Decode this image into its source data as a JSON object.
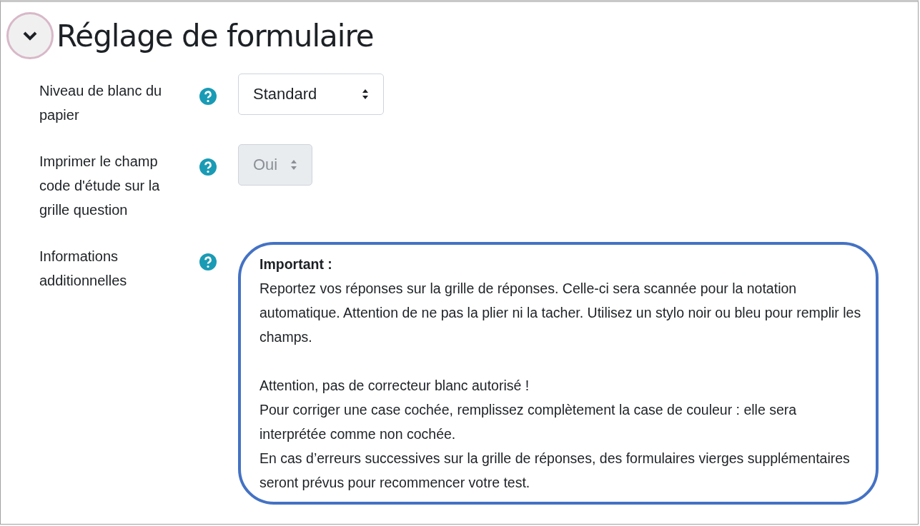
{
  "section": {
    "title": "Réglage de formulaire",
    "expanded": true
  },
  "fields": [
    {
      "kind": "select",
      "label": "Niveau de blanc du papier",
      "value": "Standard",
      "disabled": false
    },
    {
      "kind": "select",
      "label": "Imprimer le champ code d'étude sur la grille question",
      "value": "Oui",
      "disabled": true
    },
    {
      "kind": "info",
      "label": "Informations additionnelles",
      "heading": "Important :",
      "paragraphs": [
        [
          "Reportez vos réponses sur la grille de réponses. Celle-ci sera scannée pour la notation automatique. Attention de ne pas la plier ni la tacher. Utilisez un stylo noir ou bleu pour remplir les champs."
        ],
        [
          "Attention, pas de correcteur blanc autorisé !",
          "Pour corriger une case cochée, remplissez complètement la case de couleur : elle sera interprétée comme non cochée.",
          "En cas d’erreurs successives sur la grille de réponses, des formulaires vierges supplémentaires seront prévus pour recommencer votre test."
        ]
      ]
    }
  ]
}
